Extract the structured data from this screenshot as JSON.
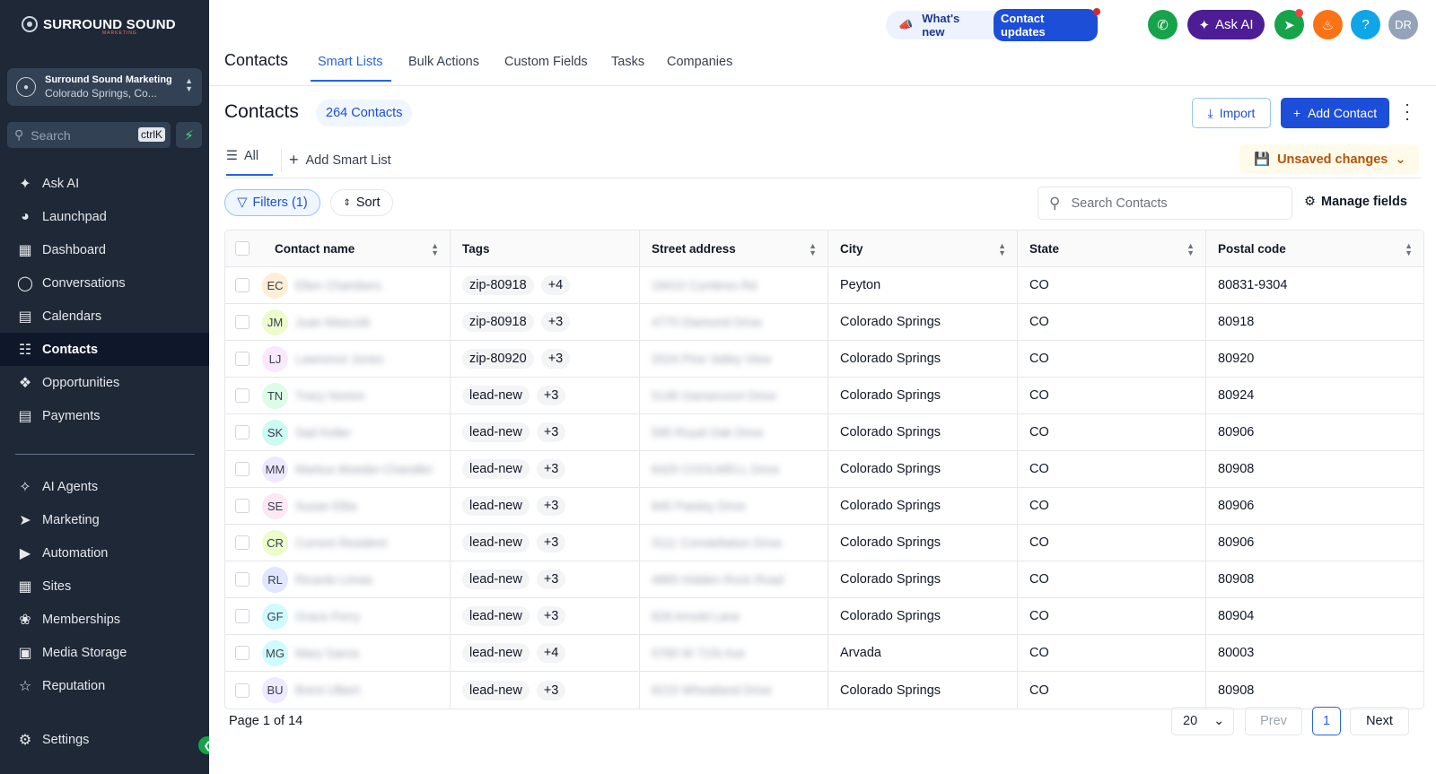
{
  "brand": {
    "name": "SURROUND SOUND",
    "sub": "MARKETING"
  },
  "account": {
    "name": "Surround Sound Marketing",
    "location": "Colorado Springs, Co..."
  },
  "search": {
    "placeholder": "Search",
    "shortcut": "ctrlK"
  },
  "sidebar": {
    "items": [
      {
        "label": "Ask AI",
        "icon": "sparkle-icon"
      },
      {
        "label": "Launchpad",
        "icon": "rocket-icon"
      },
      {
        "label": "Dashboard",
        "icon": "grid-icon"
      },
      {
        "label": "Conversations",
        "icon": "chat-icon"
      },
      {
        "label": "Calendars",
        "icon": "calendar-icon"
      },
      {
        "label": "Contacts",
        "icon": "contacts-icon",
        "active": true
      },
      {
        "label": "Opportunities",
        "icon": "pipeline-icon"
      },
      {
        "label": "Payments",
        "icon": "receipt-icon"
      },
      {
        "label": "AI Agents",
        "icon": "ai-agent-icon"
      },
      {
        "label": "Marketing",
        "icon": "send-icon"
      },
      {
        "label": "Automation",
        "icon": "automation-icon"
      },
      {
        "label": "Sites",
        "icon": "sites-icon"
      },
      {
        "label": "Memberships",
        "icon": "award-icon"
      },
      {
        "label": "Media Storage",
        "icon": "image-icon"
      },
      {
        "label": "Reputation",
        "icon": "star-icon"
      },
      {
        "label": "Settings",
        "icon": "gear-icon"
      }
    ]
  },
  "topbar": {
    "whats_new": "What's new",
    "contact_updates": "Contact updates",
    "ask_ai": "Ask AI",
    "user_initials": "DR"
  },
  "tabs": {
    "main": "Contacts",
    "items": [
      "Smart Lists",
      "Bulk Actions",
      "Custom Fields",
      "Tasks",
      "Companies"
    ]
  },
  "page": {
    "title": "Contacts",
    "count": "264 Contacts",
    "import": "Import",
    "add_contact": "Add Contact",
    "list_all": "All",
    "add_smart_list": "Add Smart List",
    "unsaved": "Unsaved changes",
    "filters": "Filters (1)",
    "sort": "Sort",
    "search_placeholder": "Search Contacts",
    "manage_fields": "Manage fields"
  },
  "table": {
    "columns": [
      "Contact name",
      "Tags",
      "Street address",
      "City",
      "State",
      "Postal code"
    ],
    "rows": [
      {
        "initials": "EC",
        "name": "Ellen Chambers",
        "avatar_color": "#ffedd5",
        "tag": "zip-80918",
        "more": "+4",
        "street": "18410 Cumbres Rd",
        "city": "Peyton",
        "state": "CO",
        "postal": "80831-9304"
      },
      {
        "initials": "JM",
        "name": "Juan Mascotti",
        "avatar_color": "#ecfccb",
        "tag": "zip-80918",
        "more": "+3",
        "street": "4770 Diamond Drive",
        "city": "Colorado Springs",
        "state": "CO",
        "postal": "80918"
      },
      {
        "initials": "LJ",
        "name": "Lawrence Jones",
        "avatar_color": "#fae8ff",
        "tag": "zip-80920",
        "more": "+3",
        "street": "2024 Pine Valley View",
        "city": "Colorado Springs",
        "state": "CO",
        "postal": "80920"
      },
      {
        "initials": "TN",
        "name": "Tracy Norton",
        "avatar_color": "#dcfce7",
        "tag": "lead-new",
        "more": "+3",
        "street": "5146 Gansevoort Drive",
        "city": "Colorado Springs",
        "state": "CO",
        "postal": "80924"
      },
      {
        "initials": "SK",
        "name": "Sad Keller",
        "avatar_color": "#ccfbf1",
        "tag": "lead-new",
        "more": "+3",
        "street": "595 Royal Oak Drive",
        "city": "Colorado Springs",
        "state": "CO",
        "postal": "80906"
      },
      {
        "initials": "MM",
        "name": "Markus Moeder-Chandler",
        "avatar_color": "#ede9fe",
        "tag": "lead-new",
        "more": "+3",
        "street": "6420 COOLWELL Drive",
        "city": "Colorado Springs",
        "state": "CO",
        "postal": "80908"
      },
      {
        "initials": "SE",
        "name": "Susan Elbe",
        "avatar_color": "#fce7f3",
        "tag": "lead-new",
        "more": "+3",
        "street": "845 Paisley Drive",
        "city": "Colorado Springs",
        "state": "CO",
        "postal": "80906"
      },
      {
        "initials": "CR",
        "name": "Current Resident",
        "avatar_color": "#ecfccb",
        "tag": "lead-new",
        "more": "+3",
        "street": "3111 Constellation Drive",
        "city": "Colorado Springs",
        "state": "CO",
        "postal": "80906"
      },
      {
        "initials": "RL",
        "name": "Ricardo Limas",
        "avatar_color": "#e0e7ff",
        "tag": "lead-new",
        "more": "+3",
        "street": "4865 Hidden Rock Road",
        "city": "Colorado Springs",
        "state": "CO",
        "postal": "80908"
      },
      {
        "initials": "GF",
        "name": "Grace Ferry",
        "avatar_color": "#cffafe",
        "tag": "lead-new",
        "more": "+3",
        "street": "828 Arnold Lane",
        "city": "Colorado Springs",
        "state": "CO",
        "postal": "80904"
      },
      {
        "initials": "MG",
        "name": "Mary Garza",
        "avatar_color": "#cffafe",
        "tag": "lead-new",
        "more": "+4",
        "street": "5780 W 71St Ave",
        "city": "Arvada",
        "state": "CO",
        "postal": "80003"
      },
      {
        "initials": "BU",
        "name": "Brent Ulbert",
        "avatar_color": "#ede9fe",
        "tag": "lead-new",
        "more": "+3",
        "street": "8215 Wheatland Drive",
        "city": "Colorado Springs",
        "state": "CO",
        "postal": "80908"
      }
    ]
  },
  "pagination": {
    "label": "Page 1 of 14",
    "per_page": "20",
    "prev": "Prev",
    "current": "1",
    "next": "Next"
  },
  "colors": {
    "sidebar": "#1e2837",
    "accent": "#1d4ed8",
    "unsaved": "#b45309"
  }
}
